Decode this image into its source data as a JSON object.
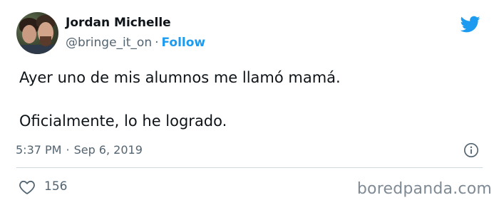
{
  "tweet": {
    "author": {
      "name": "Jordan Michelle",
      "handle": "@bringe_it_on",
      "separator": "·",
      "follow_label": "Follow"
    },
    "text_lines": [
      "Ayer uno de mis alumnos me llamó mamá.",
      "Oficialmente, lo he logrado."
    ],
    "timestamp": {
      "time": "5:37 PM",
      "separator": "·",
      "date": "Sep 6, 2019"
    },
    "likes_count": "156",
    "icons": {
      "brand": "twitter-bird-icon",
      "info": "info-icon",
      "like": "heart-icon"
    },
    "colors": {
      "accent": "#1d9bf0",
      "secondary_text": "#536471",
      "primary_text": "#0f1419",
      "divider": "#cfd9de"
    }
  },
  "watermark": "boredpanda.com"
}
